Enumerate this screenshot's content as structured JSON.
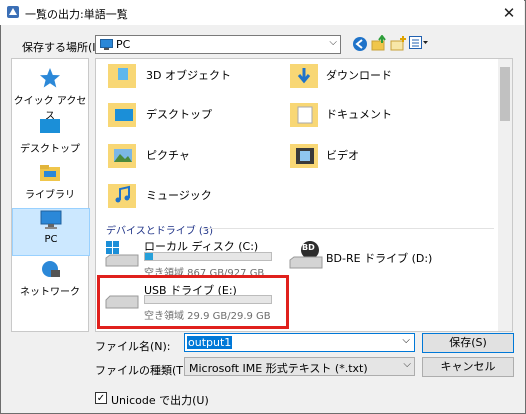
{
  "window": {
    "title": "一覧の出力:単語一覧",
    "close": "✕"
  },
  "location": {
    "label": "保存する場所(I):",
    "value": "PC"
  },
  "sidebar": {
    "items": [
      {
        "label": "クイック アクセス"
      },
      {
        "label": "デスクトップ"
      },
      {
        "label": "ライブラリ"
      },
      {
        "label": "PC"
      },
      {
        "label": "ネットワーク"
      }
    ]
  },
  "folders": [
    {
      "label": "3D オブジェクト"
    },
    {
      "label": "ダウンロード"
    },
    {
      "label": "デスクトップ"
    },
    {
      "label": "ドキュメント"
    },
    {
      "label": "ピクチャ"
    },
    {
      "label": "ビデオ"
    },
    {
      "label": "ミュージック"
    }
  ],
  "devices": {
    "header": "デバイスとドライブ (3)",
    "drives": [
      {
        "name": "ローカル ディスク (C:)",
        "free": "空き領域 867 GB/927 GB",
        "used_fraction": 0.065,
        "bar_color": "#26a0da"
      },
      {
        "name": "BD-RE ドライブ (D:)",
        "badge": "BD"
      },
      {
        "name": "USB ドライブ (E:)",
        "free": "空き領域 29.9 GB/29.9 GB",
        "used_fraction": 0.0,
        "bar_color": "#26a0da"
      }
    ]
  },
  "filename": {
    "label": "ファイル名(N):",
    "value": "output1"
  },
  "filetype": {
    "label": "ファイルの種類(T):",
    "value": "Microsoft IME 形式テキスト (*.txt)"
  },
  "buttons": {
    "save": "保存(S)",
    "cancel": "キャンセル"
  },
  "unicode": {
    "label": "Unicode で出力(U)",
    "checked": "✓"
  },
  "colors": {
    "accent": "#0078d7",
    "highlight_box": "#e0201c",
    "folder": "#f8d775"
  }
}
